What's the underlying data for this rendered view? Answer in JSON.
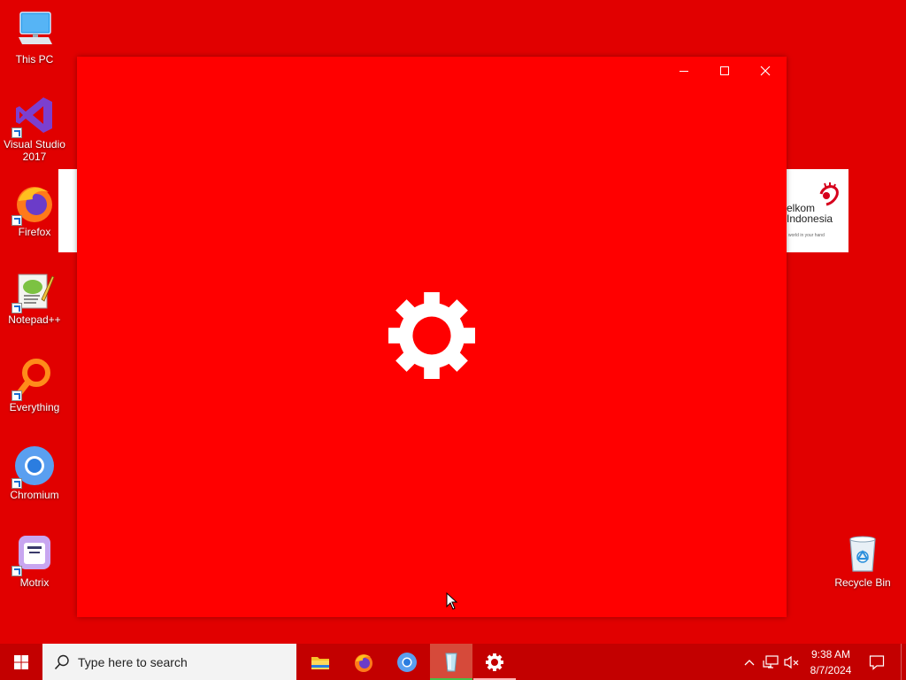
{
  "desktop": {
    "icons": [
      {
        "label": "This PC"
      },
      {
        "label": "Visual Studio\n2017"
      },
      {
        "label": "Firefox"
      },
      {
        "label": "Notepad++"
      },
      {
        "label": "Everything"
      },
      {
        "label": "Chromium"
      },
      {
        "label": "Motrix"
      },
      {
        "label": "Recycle Bin"
      }
    ]
  },
  "background_window": {
    "logo_text": "elkom\nIndonesia",
    "logo_tagline": "world in your hand"
  },
  "splash": {
    "background_color": "#ff0000",
    "center_icon": "gear-icon",
    "controls": [
      "minimize-icon",
      "maximize-icon",
      "close-icon"
    ]
  },
  "taskbar": {
    "search_placeholder": "Type here to search",
    "pinned": [
      "file-explorer-icon",
      "firefox-icon",
      "chromium-icon",
      "notepad-app-icon",
      "settings-gear-icon"
    ],
    "tray": {
      "time": "9:38 AM",
      "date": "8/7/2024"
    }
  },
  "colors": {
    "desktop": "#e10000",
    "taskbar": "#c30000",
    "accent_underline": "#48c048"
  }
}
